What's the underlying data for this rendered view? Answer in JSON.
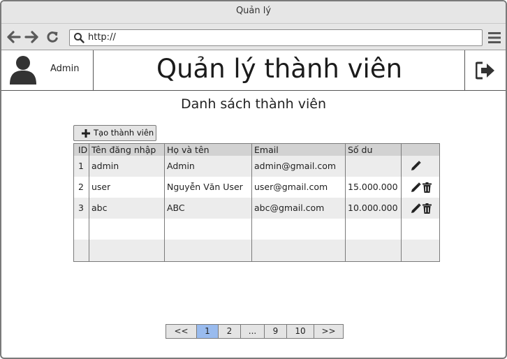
{
  "window": {
    "title": "Quản lý"
  },
  "toolbar": {
    "url": "http://"
  },
  "header": {
    "username": "Admin",
    "title": "Quản lý thành viên"
  },
  "content": {
    "section_title": "Danh sách thành viên",
    "create_button": "Tạo thành viên"
  },
  "table": {
    "columns": [
      "ID",
      "Tên đăng nhập",
      "Họ và tên",
      "Email",
      "Số dư",
      ""
    ],
    "rows": [
      {
        "id": "1",
        "username": "admin",
        "fullname": "Admin",
        "email": "admin@gmail.com",
        "balance": "",
        "actions": [
          "edit-icon"
        ]
      },
      {
        "id": "2",
        "username": "user",
        "fullname": "Nguyễn Văn User",
        "email": "user@gmail.com",
        "balance": "15.000.000",
        "actions": [
          "edit-icon",
          "trash-icon"
        ]
      },
      {
        "id": "3",
        "username": "abc",
        "fullname": "ABC",
        "email": "abc@gmail.com",
        "balance": "10.000.000",
        "actions": [
          "edit-icon",
          "trash-icon"
        ]
      }
    ]
  },
  "pagination": {
    "items": [
      "<<",
      "1",
      "2",
      "...",
      "9",
      "10",
      ">>"
    ],
    "active": "1"
  },
  "colors": {
    "chrome_bg": "#e6e6e6",
    "header_row": "#d2d2d2",
    "row_alt": "#ececec",
    "active_page": "#99bbee"
  }
}
